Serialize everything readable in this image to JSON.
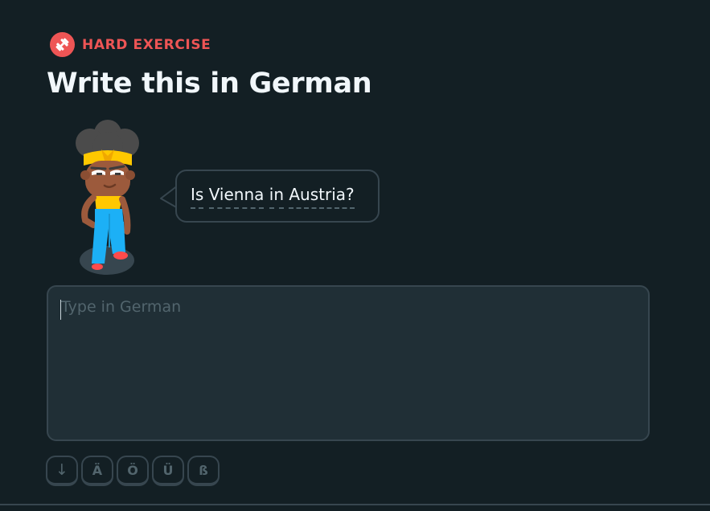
{
  "badge": {
    "icon": "dumbbell-icon",
    "label": "HARD EXERCISE",
    "color": "#ee5555"
  },
  "title": "Write this in German",
  "prompt": {
    "words": [
      "Is",
      "Vienna",
      "in",
      "Austria?"
    ]
  },
  "answer": {
    "placeholder": "Type in German",
    "value": ""
  },
  "special_keys": [
    "↓",
    "Ä",
    "Ö",
    "Ü",
    "ß"
  ],
  "colors": {
    "background": "#131f24",
    "input_background": "#202f36",
    "border": "#37464f",
    "text": "#f1f7fb",
    "muted": "#52656d"
  }
}
